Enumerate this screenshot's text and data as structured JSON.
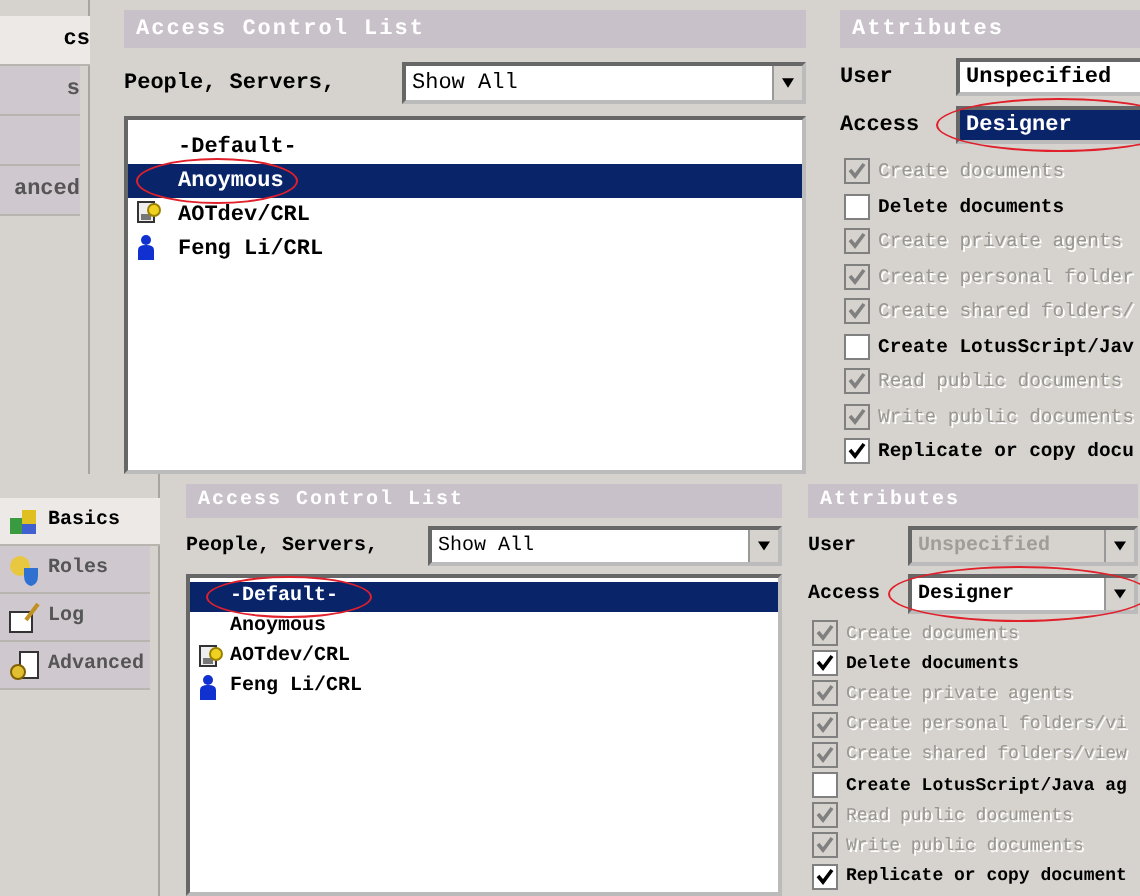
{
  "panels": [
    {
      "kind": "cropped",
      "nav": [
        {
          "label": "cs",
          "selected": true
        },
        {
          "label": "s",
          "selected": false
        },
        {
          "selected": false
        },
        {
          "label": "anced",
          "selected": false
        }
      ],
      "acl": {
        "title": "Access Control List",
        "filter_label": "People, Servers,",
        "filter_value": "Show All",
        "entries": [
          {
            "name": "-Default-",
            "kind": "plain",
            "selected": false,
            "circled": false
          },
          {
            "name": "Anoymous",
            "kind": "plain",
            "selected": true,
            "circled": true
          },
          {
            "name": "AOTdev/CRL",
            "kind": "server",
            "selected": false,
            "circled": false
          },
          {
            "name": "Feng Li/CRL",
            "kind": "person",
            "selected": false,
            "circled": false
          }
        ]
      },
      "attributes": {
        "title": "Attributes",
        "user": {
          "label": "User",
          "value": "Unspecified",
          "disabled": false
        },
        "access": {
          "label": "Access",
          "value": "Designer",
          "highlighted": true,
          "circled": true
        },
        "options": [
          {
            "label": "Create documents",
            "checked": true,
            "disabled": true
          },
          {
            "label": "Delete documents",
            "checked": false,
            "disabled": false
          },
          {
            "label": "Create private agents",
            "checked": true,
            "disabled": true
          },
          {
            "label": "Create personal folder",
            "checked": true,
            "disabled": true
          },
          {
            "label": "Create shared folders/",
            "checked": true,
            "disabled": true
          },
          {
            "label": "Create LotusScript/Jav",
            "checked": false,
            "disabled": false
          },
          {
            "label": "Read public documents",
            "checked": true,
            "disabled": true
          },
          {
            "label": "Write public documents",
            "checked": true,
            "disabled": true
          },
          {
            "label": "Replicate or copy docu",
            "checked": true,
            "disabled": false
          }
        ]
      }
    },
    {
      "kind": "full",
      "nav": [
        {
          "label": "Basics",
          "selected": true
        },
        {
          "label": "Roles",
          "selected": false
        },
        {
          "label": "Log",
          "selected": false
        },
        {
          "label": "Advanced",
          "selected": false
        }
      ],
      "acl": {
        "title": "Access Control List",
        "filter_label": "People, Servers,",
        "filter_value": "Show All",
        "entries": [
          {
            "name": "-Default-",
            "kind": "plain",
            "selected": true,
            "circled": true
          },
          {
            "name": "Anoymous",
            "kind": "plain",
            "selected": false,
            "circled": false
          },
          {
            "name": "AOTdev/CRL",
            "kind": "server",
            "selected": false,
            "circled": false
          },
          {
            "name": "Feng Li/CRL",
            "kind": "person",
            "selected": false,
            "circled": false
          }
        ]
      },
      "attributes": {
        "title": "Attributes",
        "user": {
          "label": "User",
          "value": "Unspecified",
          "disabled": true
        },
        "access": {
          "label": "Access",
          "value": "Designer",
          "highlighted": false,
          "circled": true
        },
        "options": [
          {
            "label": "Create documents",
            "checked": true,
            "disabled": true
          },
          {
            "label": "Delete documents",
            "checked": true,
            "disabled": false
          },
          {
            "label": "Create private agents",
            "checked": true,
            "disabled": true
          },
          {
            "label": "Create personal folders/vi",
            "checked": true,
            "disabled": true
          },
          {
            "label": "Create shared folders/view",
            "checked": true,
            "disabled": true
          },
          {
            "label": "Create LotusScript/Java ag",
            "checked": false,
            "disabled": false
          },
          {
            "label": "Read public documents",
            "checked": true,
            "disabled": true
          },
          {
            "label": "Write public documents",
            "checked": true,
            "disabled": true
          },
          {
            "label": "Replicate or copy document",
            "checked": true,
            "disabled": false
          }
        ]
      }
    }
  ]
}
